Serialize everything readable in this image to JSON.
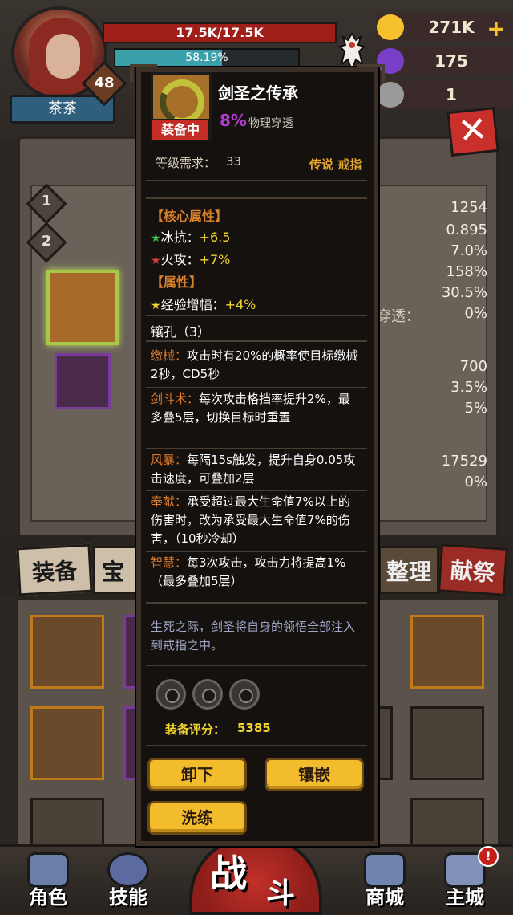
{
  "player": {
    "name": "茶茶",
    "level": "48",
    "hp_text": "17.5K/17.5K",
    "xp_text": "58.19%",
    "xp_fraction": 0.5819
  },
  "resources": {
    "gold": "271K",
    "gems": "175",
    "keys": "1",
    "gold_color": "#f5c02e",
    "gem_color": "#7a3fc8",
    "key_color": "#9a9a9a"
  },
  "sidebar": {
    "page1": "1",
    "page2": "2"
  },
  "stats_bg": {
    "values": [
      "1254",
      "0.895",
      "7.0%",
      "158%",
      "30.5%",
      "0%",
      "700",
      "3.5%",
      "5%",
      "17529",
      "0%"
    ],
    "pen_label": "穿透："
  },
  "tabs": {
    "equip": "装备",
    "treasure": "宝石",
    "sort": "整理",
    "offer": "献祭"
  },
  "nav": {
    "role": "角色",
    "skill": "技能",
    "battle_1": "战",
    "battle_2": "斗",
    "shop": "商城",
    "city": "主城",
    "notify": "!"
  },
  "item": {
    "name": "剑圣之传承",
    "equipped_tag": "装备中",
    "main_stat_pct": "8%",
    "main_stat_label": "物理穿透",
    "req_label": "等级需求：",
    "req_value": "33",
    "rarity": "传说 戒指",
    "core_title": "【核心属性】",
    "core_attrs": [
      {
        "name": "冰抗：",
        "value": "+6.5",
        "star_color": "#3fbf3f"
      },
      {
        "name": "火攻：",
        "value": "+7%",
        "star_color": "#e04040"
      }
    ],
    "attr_title": "【属性】",
    "attrs": [
      {
        "name": "经验增幅：",
        "value": "+4%",
        "star_color": "#f1d530"
      }
    ],
    "socket_title": "镶孔（3）",
    "skills": [
      {
        "name": "缴械：",
        "desc": "攻击时有20%的概率使目标缴械2秒，CD5秒"
      },
      {
        "name": "剑斗术：",
        "desc": "每次攻击格挡率提升2%，最多叠5层，切换目标时重置"
      },
      {
        "name": "风暴：",
        "desc": "每隔15s触发，提升自身0.05攻击速度，可叠加2层"
      },
      {
        "name": "奉献：",
        "desc": "承受超过最大生命值7%以上的伤害时，改为承受最大生命值7%的伤害，（10秒冷却）"
      },
      {
        "name": "智慧：",
        "desc": "每3次攻击，攻击力将提高1%（最多叠加5层）"
      }
    ],
    "flavor": "生死之际，剑圣将自身的领悟全部注入到戒指之中。",
    "score_label": "装备评分：",
    "score_value": "5385",
    "buttons": {
      "unequip": "卸下",
      "inlay": "镶嵌",
      "reforge": "洗练"
    },
    "accent_color": "#f2bc2d"
  }
}
